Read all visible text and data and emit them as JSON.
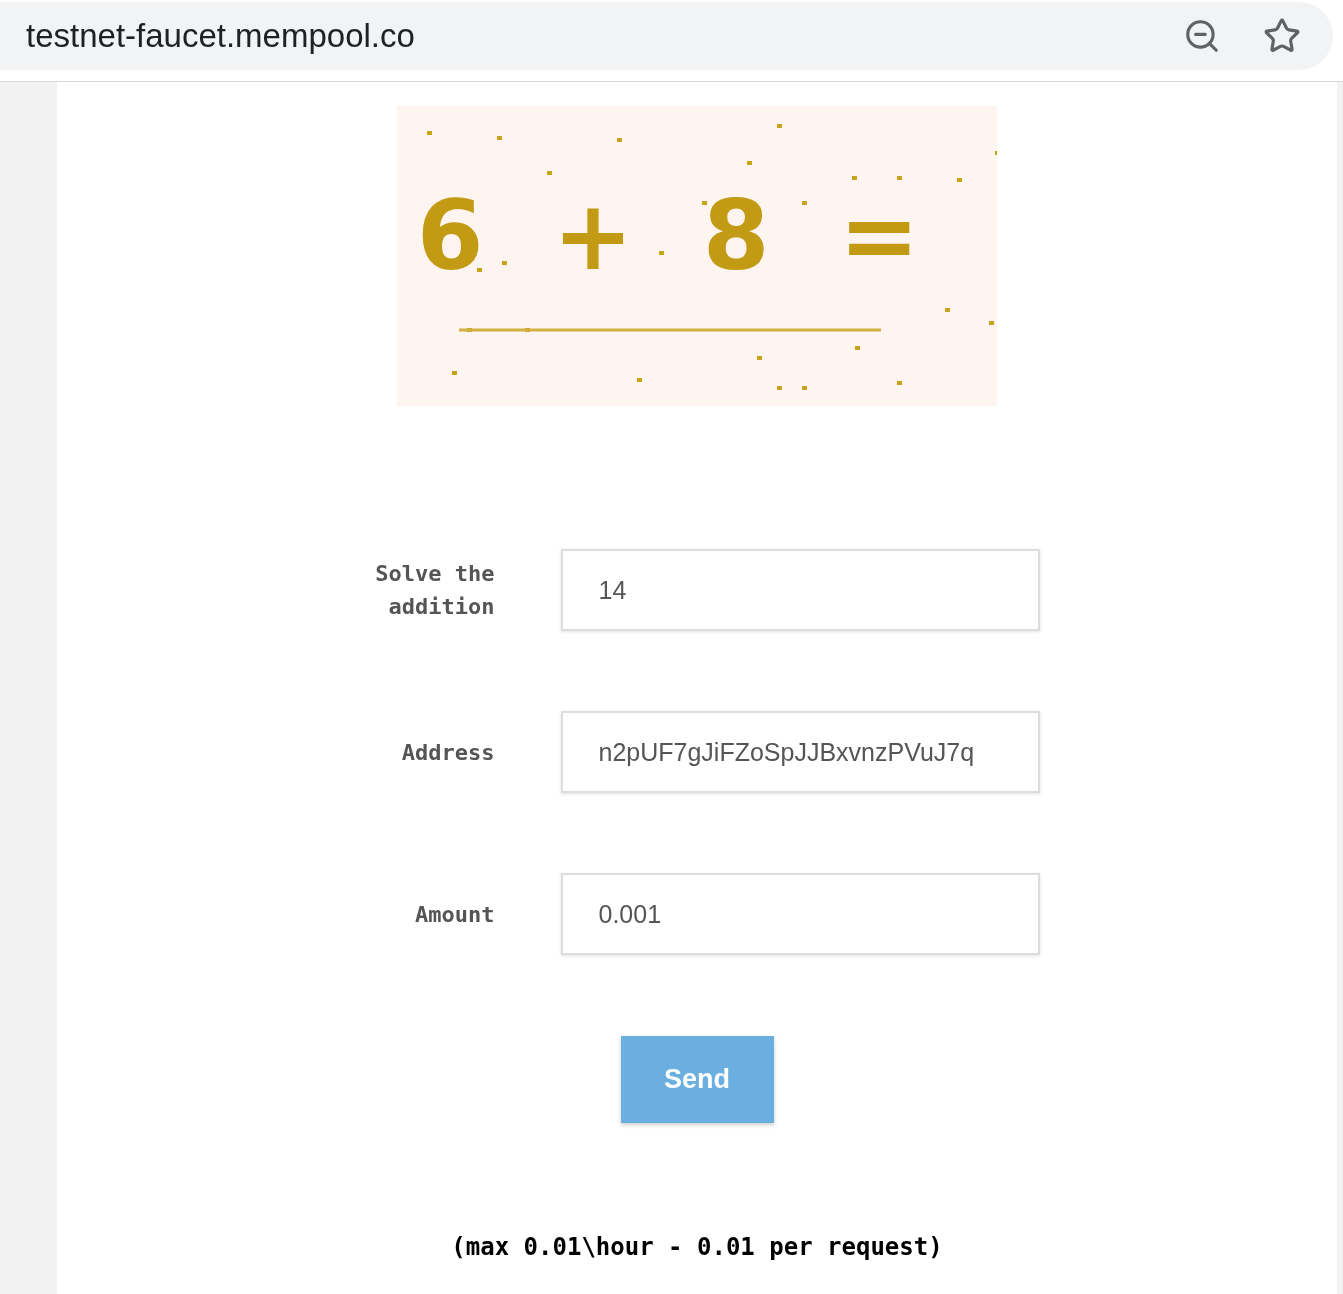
{
  "browser": {
    "url": "testnet-faucet.mempool.co"
  },
  "captcha": {
    "text": "6 + 8 ="
  },
  "form": {
    "fields": [
      {
        "label": "Solve the addition",
        "value": "14"
      },
      {
        "label": "Address",
        "value": "n2pUF7gJiFZoSpJJBxvnzPVuJ7q"
      },
      {
        "label": "Amount",
        "value": "0.001"
      }
    ],
    "submit": "Send"
  },
  "footer": "(max 0.01\\hour - 0.01 per request)"
}
